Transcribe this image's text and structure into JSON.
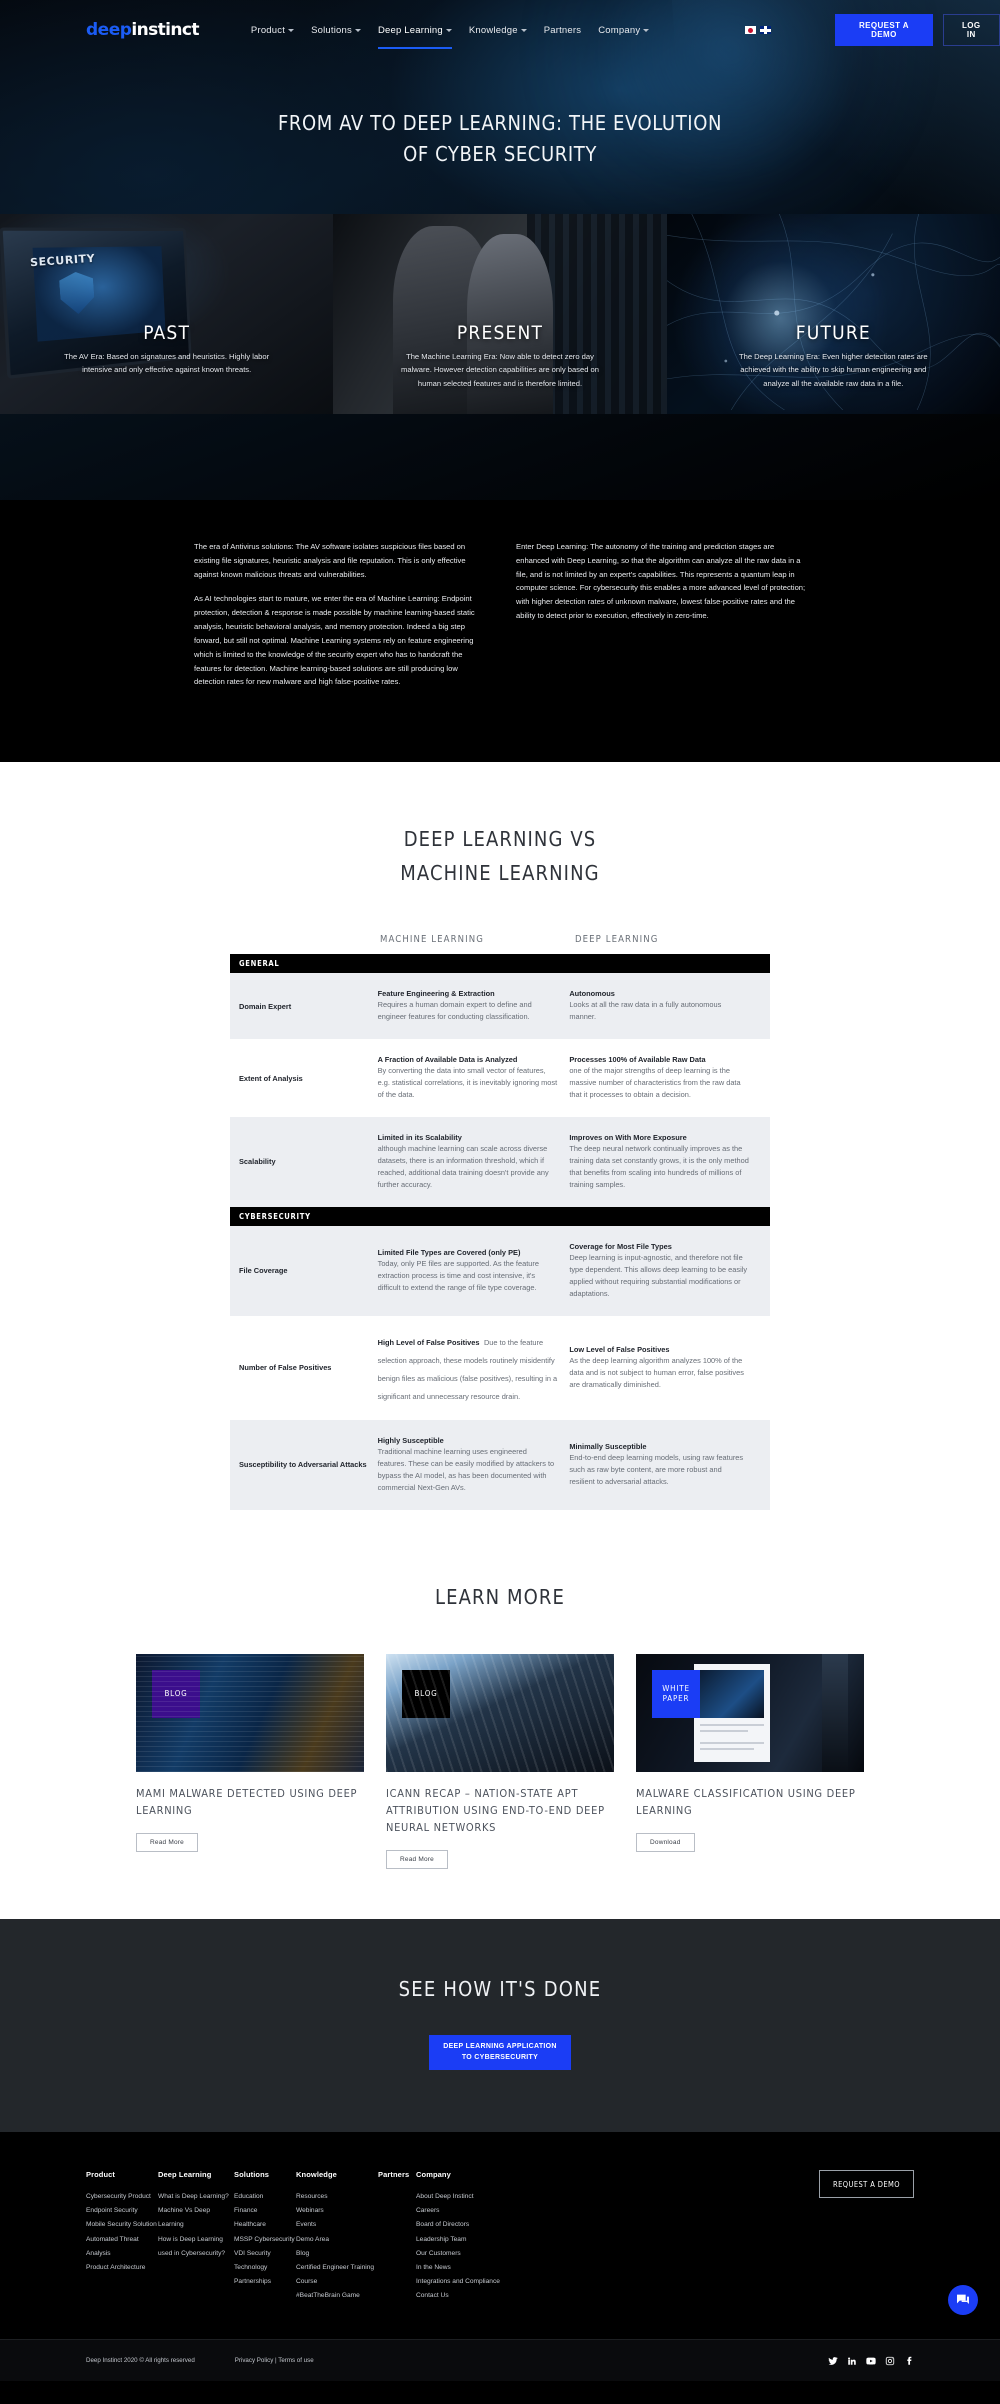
{
  "header": {
    "logo": {
      "part1": "deep",
      "part2": "instinct"
    },
    "nav": [
      {
        "label": "Product",
        "caret": true,
        "active": false
      },
      {
        "label": "Solutions",
        "caret": true,
        "active": false
      },
      {
        "label": "Deep Learning",
        "caret": true,
        "active": true
      },
      {
        "label": "Knowledge",
        "caret": true,
        "active": false
      },
      {
        "label": "Partners",
        "caret": false,
        "active": false
      },
      {
        "label": "Company",
        "caret": true,
        "active": false
      }
    ],
    "languages": [
      "japan-flag-icon",
      "uk-flag-icon"
    ],
    "request_demo": "REQUEST A DEMO",
    "log_in": "LOG IN"
  },
  "hero": {
    "title_line1": "FROM AV TO DEEP LEARNING: THE EVOLUTION",
    "title_line2": "OF CYBER SECURITY"
  },
  "eras": [
    {
      "title": "PAST",
      "body": "The AV Era: Based on signatures and heuristics. Highly labor intensive and only effective against known threats.",
      "screen_label": "SECURITY"
    },
    {
      "title": "PRESENT",
      "body": "The Machine Learning Era: Now able to detect zero day malware. However detection capabilities are only based on human selected features and is therefore limited."
    },
    {
      "title": "FUTURE",
      "body": "The Deep Learning Era: Even higher detection rates are achieved with the ability to skip human engineering and analyze all the available raw data in a file."
    }
  ],
  "intro": {
    "left": [
      "The era of Antivirus solutions: The AV software isolates suspicious files based on existing file signatures, heuristic analysis and file reputation. This is only effective against known malicious threats and vulnerabilities.",
      "As AI technologies start to mature, we enter the era of Machine Learning: Endpoint protection, detection & response is made possible by machine learning-based static analysis, heuristic behavioral analysis, and memory protection. Indeed a big step forward, but still not optimal. Machine Learning systems rely on feature engineering which is limited to the knowledge of the security expert who has to handcraft the features for detection. Machine learning-based solutions are still producing low detection rates for new malware and high false-positive rates."
    ],
    "right": [
      "Enter Deep Learning: The autonomy of the training and prediction stages are enhanced with Deep Learning, so that the algorithm can analyze all the raw data in a file, and is not limited by an expert's capabilities. This represents a quantum leap in computer science. For cybersecurity this enables a more advanced level of protection; with higher detection rates of unknown malware, lowest false-positive rates and the ability to detect prior to execution, effectively in zero-time."
    ]
  },
  "comparison": {
    "heading_line1": "DEEP LEARNING VS",
    "heading_line2": "MACHINE LEARNING",
    "columns": [
      "",
      "MACHINE LEARNING",
      "DEEP LEARNING"
    ],
    "sections": [
      {
        "band": "GENERAL",
        "rows": [
          {
            "label": "Domain Expert",
            "ml_title": "Feature Engineering & Extraction",
            "ml_text": "Requires a human domain expert to define and engineer features for conducting classification.",
            "dl_title": "Autonomous",
            "dl_text": "Looks at all the raw data in a fully autonomous manner."
          },
          {
            "label": "Extent of Analysis",
            "ml_title": "A Fraction of Available Data is Analyzed",
            "ml_text": "By converting the data into small vector of features, e.g. statistical correlations, it is inevitably ignoring most of the data.",
            "dl_title": "Processes 100% of Available Raw Data",
            "dl_text": "one of the major strengths of deep learning is the massive number of characteristics from the raw data that it processes to obtain a decision."
          },
          {
            "label": "Scalability",
            "ml_title": "Limited in its Scalability",
            "ml_text": "although machine learning can scale across diverse datasets, there is an information threshold, which if reached, additional data training doesn't provide any further accuracy.",
            "dl_title": "Improves on With More Exposure",
            "dl_text": "The deep neural network continually improves as the training data set constantly grows, it is the only method that benefits from scaling into hundreds of millions of training samples."
          }
        ]
      },
      {
        "band": "CYBERSECURITY",
        "rows": [
          {
            "label": "File Coverage",
            "ml_title": "Limited File Types are Covered (only PE)",
            "ml_text": "Today, only PE files are supported. As the feature extraction process is time and cost intensive, it's difficult to extend the range of file type coverage.",
            "dl_title": "Coverage for Most File Types",
            "dl_text": "Deep learning is input-agnostic, and therefore not file type dependent. This allows deep learning to be easily applied without requiring substantial modifications or adaptations."
          },
          {
            "label": "Number of False Positives",
            "ml_title": "High Level of False Positives",
            "ml_text": "Due to the feature selection approach, these models routinely misidentify benign files as malicious (false positives), resulting in a significant and unnecessary resource drain.",
            "ml_inline": true,
            "dl_title": "Low Level of False Positives",
            "dl_text": "As the deep learning algorithm analyzes 100% of the data and is not subject to human error, false positives are dramatically diminished."
          },
          {
            "label": "Susceptibility to Adversarial Attacks",
            "ml_title": "Highly Susceptible",
            "ml_text": "Traditional machine learning uses engineered features. These can be easily modified by attackers to bypass the AI model, as has been documented with commercial Next-Gen AVs.",
            "dl_title": "Minimally Susceptible",
            "dl_text": "End-to-end deep learning models, using raw features such as raw byte content, are more robust and resilient to adversarial attacks."
          }
        ]
      }
    ]
  },
  "learn_more": {
    "heading": "LEARN MORE",
    "cards": [
      {
        "badge": "BLOG",
        "badge_style": "purple",
        "title": "MAMI MALWARE DETECTED USING DEEP LEARNING",
        "button": "Read More"
      },
      {
        "badge": "BLOG",
        "badge_style": "black",
        "title": "ICANN RECAP – NATION-STATE APT ATTRIBUTION USING END-TO-END DEEP NEURAL NETWORKS",
        "button": "Read More"
      },
      {
        "badge": "WHITE PAPER",
        "badge_style": "blue",
        "title": "MALWARE CLASSIFICATION USING DEEP LEARNING",
        "button": "Download"
      }
    ]
  },
  "cta": {
    "heading": "SEE HOW IT'S DONE",
    "button_line1": "DEEP LEARNING APPLICATION",
    "button_line2": "TO CYBERSECURITY"
  },
  "footer": {
    "columns": [
      {
        "title": "Product",
        "links": [
          "Cybersecurity Product",
          "Endpoint Security",
          "Mobile Security Solution",
          "Automated Threat Analysis",
          "Product Architecture"
        ]
      },
      {
        "title": "Deep Learning",
        "links": [
          "What is Deep Learning?",
          "Machine Vs Deep Learning",
          "How is Deep Learning used in Cybersecurity?"
        ]
      },
      {
        "title": "Solutions",
        "links": [
          "Education",
          "Finance",
          "Healthcare",
          "MSSP Cybersecurity",
          "VDI Security",
          "Technology Partnerships"
        ]
      },
      {
        "title": "Knowledge",
        "links": [
          "Resources",
          "Webinars",
          "Events",
          "Demo Area",
          "Blog",
          "Certified Engineer Training Course",
          "#BeatTheBrain Game"
        ]
      },
      {
        "title": "Partners",
        "links": []
      },
      {
        "title": "Company",
        "links": [
          "About Deep Instinct",
          "Careers",
          "Board of Directors",
          "Leadership Team",
          "Our Customers",
          "In the News",
          "Integrations and Compliance",
          "Contact Us"
        ]
      }
    ],
    "request_demo": "REQUEST A DEMO",
    "copyright": "Deep Instinct 2020 © All rights reserved",
    "legal": "Privacy Policy | Terms of use",
    "socials": [
      "twitter-icon",
      "linkedin-icon",
      "youtube-icon",
      "instagram-icon",
      "facebook-icon"
    ],
    "chat": "chat-bubble-icon"
  }
}
